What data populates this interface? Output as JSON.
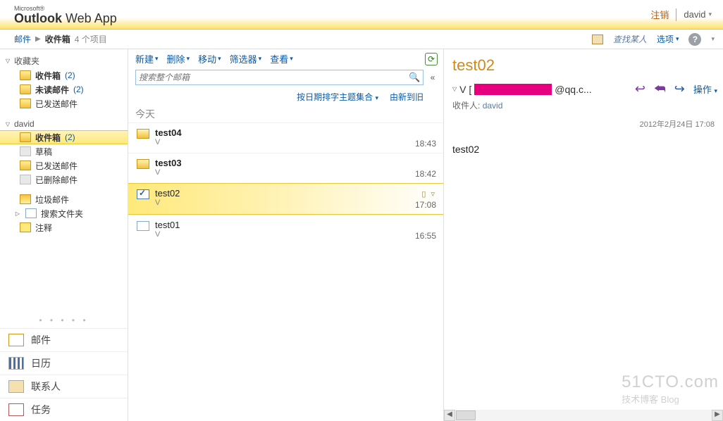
{
  "header": {
    "ms": "Microsoft®",
    "brand_a": "Outlook",
    "brand_b": " Web App",
    "signout": "注销",
    "user": "david"
  },
  "breadcrumb": {
    "root": "邮件",
    "current": "收件箱",
    "count": "4 个项目",
    "find_person": "查找某人",
    "options": "选项"
  },
  "nav": {
    "fav_label": "收藏夹",
    "fav": {
      "inbox": "收件箱",
      "inbox_count": "(2)",
      "unread": "未读邮件",
      "unread_count": "(2)",
      "sent": "已发送邮件"
    },
    "mailbox_label": "david",
    "mb": {
      "inbox": "收件箱",
      "inbox_count": "(2)",
      "drafts": "草稿",
      "sent": "已发送邮件",
      "deleted": "已删除邮件",
      "junk": "垃圾邮件",
      "search": "搜索文件夹",
      "notes": "注释"
    },
    "bottom": {
      "mail": "邮件",
      "calendar": "日历",
      "contacts": "联系人",
      "tasks": "任务"
    }
  },
  "toolbar": {
    "new": "新建",
    "delete": "删除",
    "move": "移动",
    "filter": "筛选器",
    "view": "查看"
  },
  "search": {
    "placeholder": "搜索整个邮箱"
  },
  "sort": {
    "arrange": "按日期排字主题集合",
    "order": "由新到旧"
  },
  "list": {
    "group": "今天",
    "items": [
      {
        "subject": "test04",
        "from": "V",
        "time": "18:43",
        "icon": "unread",
        "bold": true
      },
      {
        "subject": "test03",
        "from": "V",
        "time": "18:42",
        "icon": "unread",
        "bold": true
      },
      {
        "subject": "test02",
        "from": "V",
        "time": "17:08",
        "icon": "checked",
        "bold": false,
        "selected": true
      },
      {
        "subject": "test01",
        "from": "V",
        "time": "16:55",
        "icon": "read",
        "bold": false
      }
    ]
  },
  "reading": {
    "subject": "test02",
    "from_prefix": "V [",
    "from_suffix": "@qq.c...",
    "to_label": "收件人:",
    "to_value": "david",
    "date": "2012年2月24日  17:08",
    "actions_label": "操作",
    "body": "test02"
  },
  "watermark": {
    "big": "51CTO.com",
    "small": "技术博客  Blog"
  }
}
